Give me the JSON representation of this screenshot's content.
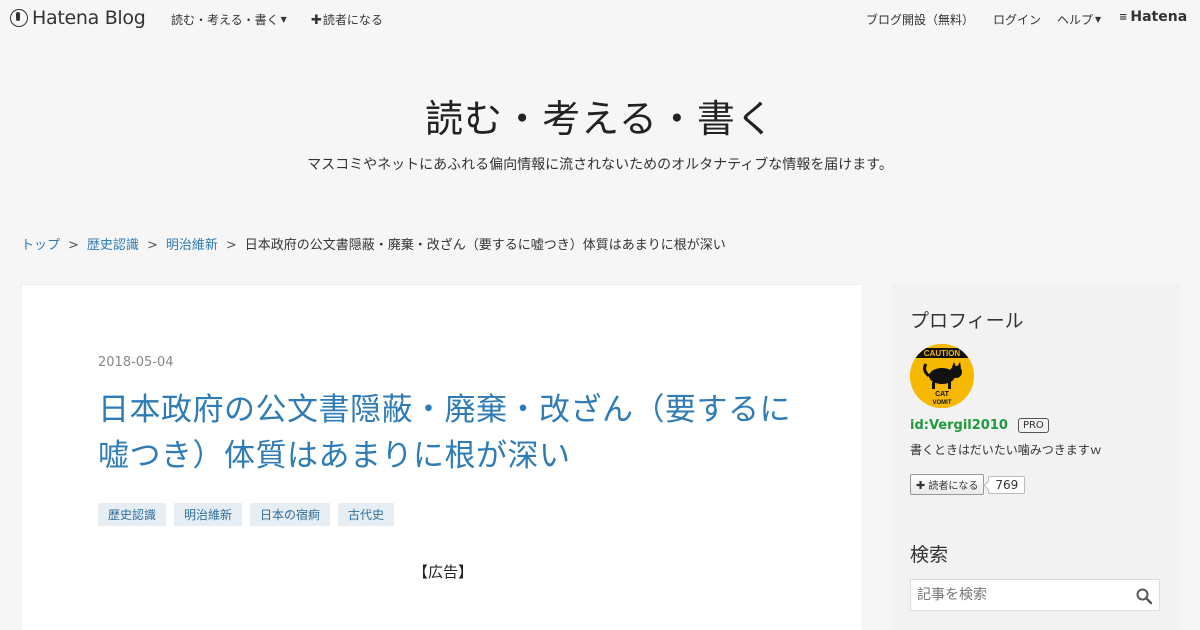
{
  "topbar": {
    "logo": "Hatena Blog",
    "blog_menu": "読む・考える・書く",
    "subscribe": "読者になる",
    "open_blog": "ブログ開設（無料）",
    "login": "ログイン",
    "help": "ヘルプ",
    "hatena": "Hatena"
  },
  "header": {
    "title": "読む・考える・書く",
    "description": "マスコミやネットにあふれる偏向情報に流されないためのオルタナティブな情報を届けます。"
  },
  "breadcrumb": {
    "items": [
      "トップ",
      "歴史認識",
      "明治維新"
    ],
    "current": "日本政府の公文書隠蔽・廃棄・改ざん（要するに嘘つき）体質はあまりに根が深い"
  },
  "article": {
    "date": "2018-05-04",
    "title": "日本政府の公文書隠蔽・廃棄・改ざん（要するに嘘つき）体質はあまりに根が深い",
    "tags": [
      "歴史認識",
      "明治維新",
      "日本の宿痾",
      "古代史"
    ],
    "ad_label": "【広告】"
  },
  "sidebar": {
    "profile_heading": "プロフィール",
    "avatar_text": {
      "top": "CAUTION",
      "bottom1": "CAT",
      "bottom2": "VOMIT"
    },
    "user_id": "id:Vergil2010",
    "pro_badge": "PRO",
    "user_desc": "書くときはだいたい噛みつきますｗ",
    "subscribe_label": "読者になる",
    "subscriber_count": "769",
    "search_heading": "検索",
    "search_placeholder": "記事を検索"
  },
  "colors": {
    "link_blue": "#2e7bb5",
    "user_green": "#1f9a3c",
    "avatar_yellow": "#f6b800"
  }
}
